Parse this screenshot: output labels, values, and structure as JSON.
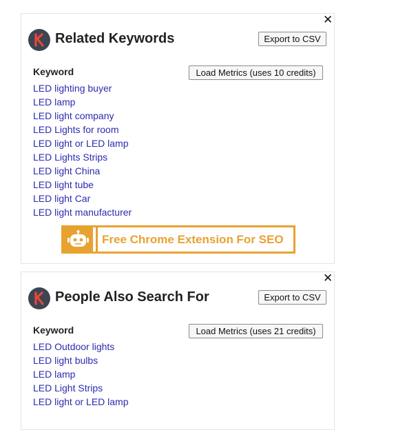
{
  "related": {
    "title": "Related Keywords",
    "export_label": "Export to CSV",
    "load_label": "Load Metrics (uses 10 credits)",
    "column_header": "Keyword",
    "keywords": [
      "LED lighting buyer",
      "LED lamp",
      "LED light company",
      "LED Lights for room",
      "LED light or LED lamp",
      "LED Lights Strips",
      "LED light China",
      "LED light tube",
      "LED light Car",
      "LED light manufacturer"
    ],
    "promo_text": "Free Chrome Extension For SEO",
    "close_icon": "close-icon"
  },
  "people": {
    "title": "People Also Search For",
    "export_label": "Export to CSV",
    "load_label": "Load Metrics (uses 21 credits)",
    "column_header": "Keyword",
    "keywords": [
      "LED Outdoor lights",
      "LED light bulbs",
      "LED lamp",
      "LED Light Strips",
      "LED light or LED lamp"
    ],
    "close_icon": "close-icon"
  },
  "colors": {
    "accent_orange": "#e8a230",
    "link_blue": "#2b2bb0",
    "logo_bg": "#3c4552",
    "logo_k": "#e8463c"
  }
}
